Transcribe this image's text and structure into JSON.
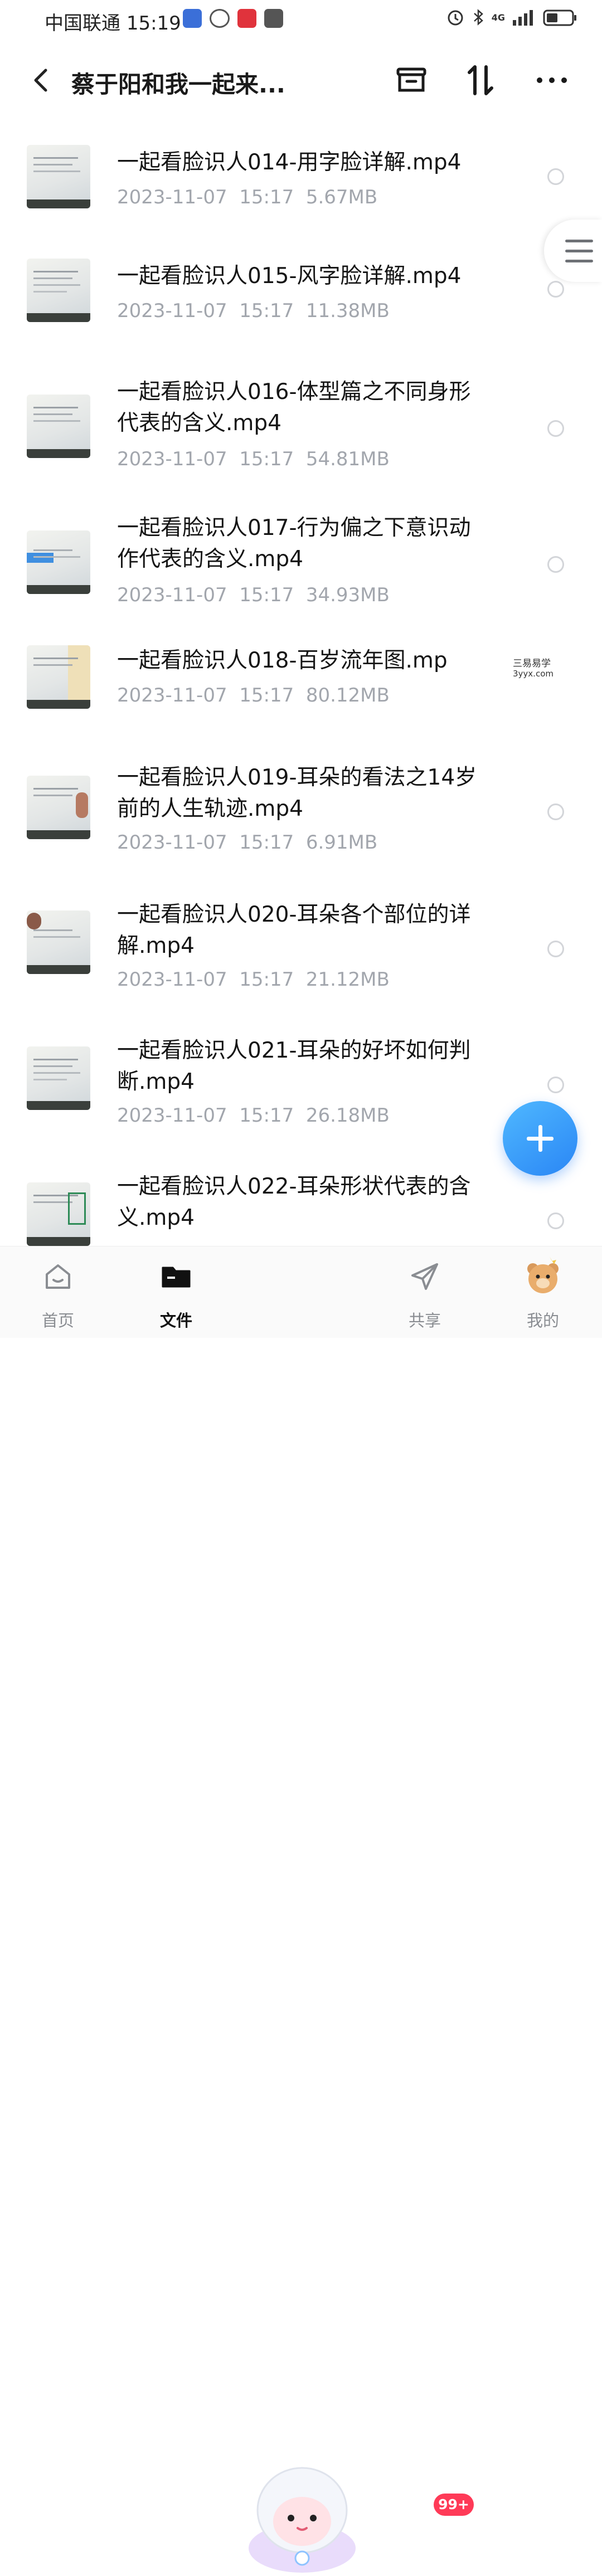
{
  "status_bar": {
    "carrier": "中国联通",
    "time": "15:19",
    "network": "4G",
    "battery_level": 0.45
  },
  "header": {
    "title": "蔡于阳和我一起来..."
  },
  "files": [
    {
      "name": "一起看脸识人014-用字脸详解.mp4",
      "date": "2023-11-07",
      "time": "15:17",
      "size": "5.67MB"
    },
    {
      "name": "一起看脸识人015-风字脸详解.mp4",
      "date": "2023-11-07",
      "time": "15:17",
      "size": "11.38MB"
    },
    {
      "name_line1": "一起看脸识人016-体型篇之不同身形",
      "name_line2": "代表的含义.mp4",
      "date": "2023-11-07",
      "time": "15:17",
      "size": "54.81MB"
    },
    {
      "name_line1": "一起看脸识人017-行为偏之下意识动",
      "name_line2": "作代表的含义.mp4",
      "date": "2023-11-07",
      "time": "15:17",
      "size": "34.93MB"
    },
    {
      "name": "一起看脸识人018-百岁流年图.mp",
      "date": "2023-11-07",
      "time": "15:17",
      "size": "80.12MB"
    },
    {
      "name_line1": "一起看脸识人019-耳朵的看法之14岁",
      "name_line2": "前的人生轨迹.mp4",
      "date": "2023-11-07",
      "time": "15:17",
      "size": "6.91MB"
    },
    {
      "name_line1": "一起看脸识人020-耳朵各个部位的详",
      "name_line2": "解.mp4",
      "date": "2023-11-07",
      "time": "15:17",
      "size": "21.12MB"
    },
    {
      "name_line1": "一起看脸识人021-耳朵的好坏如何判",
      "name_line2": "断.mp4",
      "date": "2023-11-07",
      "time": "15:17",
      "size": "26.18MB"
    },
    {
      "name_line1": "一起看脸识人022-耳朵形状代表的含",
      "name_line2": "义.mp4"
    }
  ],
  "watermark": {
    "line1": "三易易学",
    "line2": "3yyx.com"
  },
  "tabbar": {
    "home": "首页",
    "files": "文件",
    "share": "共享",
    "share_badge": "99+",
    "mine": "我的"
  },
  "colors": {
    "accent": "#2a86f5",
    "badge": "#ff3a57",
    "meta_text": "#a2a6ad"
  }
}
